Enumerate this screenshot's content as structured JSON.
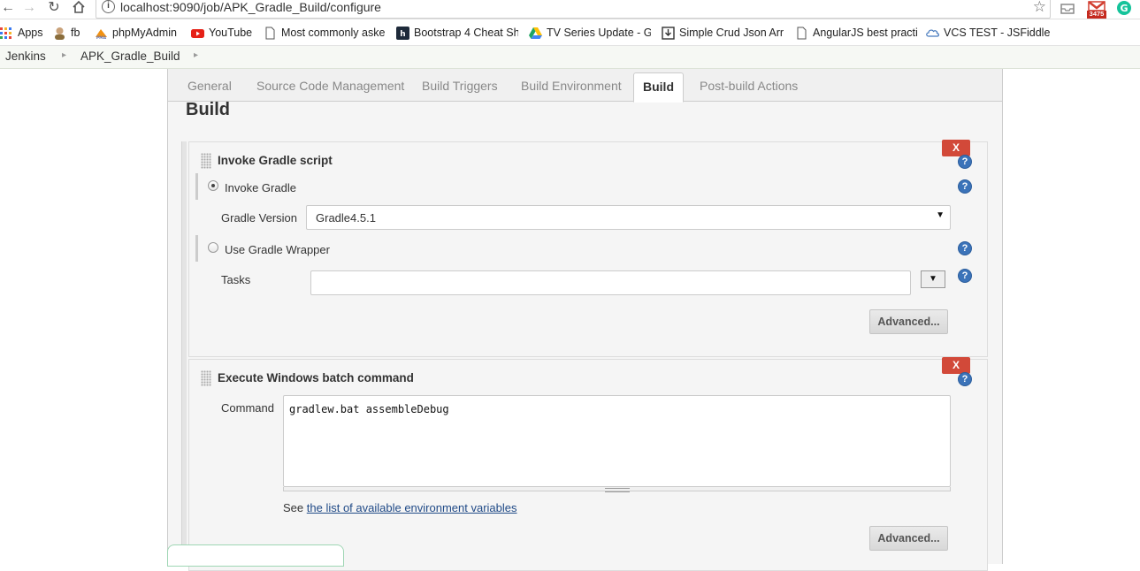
{
  "browser": {
    "url": "localhost:9090/job/APK_Gradle_Build/configure",
    "gmail_badge": "3475",
    "bookmarks": [
      {
        "label": "Apps",
        "icon": "apps-grid-icon",
        "color": "#e8453c"
      },
      {
        "label": "fb",
        "icon": "avatar-icon",
        "color": "#8a6d3b"
      },
      {
        "label": "phpMyAdmin",
        "icon": "phpmyadmin-icon",
        "color": "#f29111"
      },
      {
        "label": "YouTube",
        "icon": "youtube-icon",
        "color": "#e62117"
      },
      {
        "label": "Most commonly aske",
        "icon": "page-icon",
        "color": "#777777"
      },
      {
        "label": "Bootstrap 4 Cheat Sh",
        "icon": "hackerthemes-icon",
        "color": "#1e3a5f"
      },
      {
        "label": "TV Series Update - G",
        "icon": "google-drive-icon",
        "color": "#1fa463"
      },
      {
        "label": "Simple Crud Json Arr",
        "icon": "download-box-icon",
        "color": "#333333"
      },
      {
        "label": "AngularJS best practi",
        "icon": "page-icon",
        "color": "#777777"
      },
      {
        "label": "VCS TEST - JSFiddle",
        "icon": "cloud-icon",
        "color": "#4679bd"
      }
    ]
  },
  "breadcrumb": {
    "items": [
      "Jenkins",
      "APK_Gradle_Build"
    ]
  },
  "tabs": [
    "General",
    "Source Code Management",
    "Build Triggers",
    "Build Environment",
    "Build",
    "Post-build Actions"
  ],
  "active_tab": "Build",
  "section_title": "Build",
  "gradle_step": {
    "title": "Invoke Gradle script",
    "delete_label": "X",
    "invoke_gradle_label": "Invoke Gradle",
    "invoke_gradle_selected": true,
    "gradle_version_label": "Gradle Version",
    "gradle_version_value": "Gradle4.5.1",
    "use_wrapper_label": "Use Gradle Wrapper",
    "use_wrapper_selected": false,
    "tasks_label": "Tasks",
    "tasks_value": "",
    "advanced_label": "Advanced..."
  },
  "batch_step": {
    "title": "Execute Windows batch command",
    "delete_label": "X",
    "command_label": "Command",
    "command_value": "gradlew.bat assembleDebug",
    "see_prefix": "See",
    "env_link": "the list of available environment variables",
    "advanced_label": "Advanced..."
  },
  "colors": {
    "delete_button": "#d24939",
    "help_icon": "#3b73b9",
    "link": "#204a87"
  }
}
